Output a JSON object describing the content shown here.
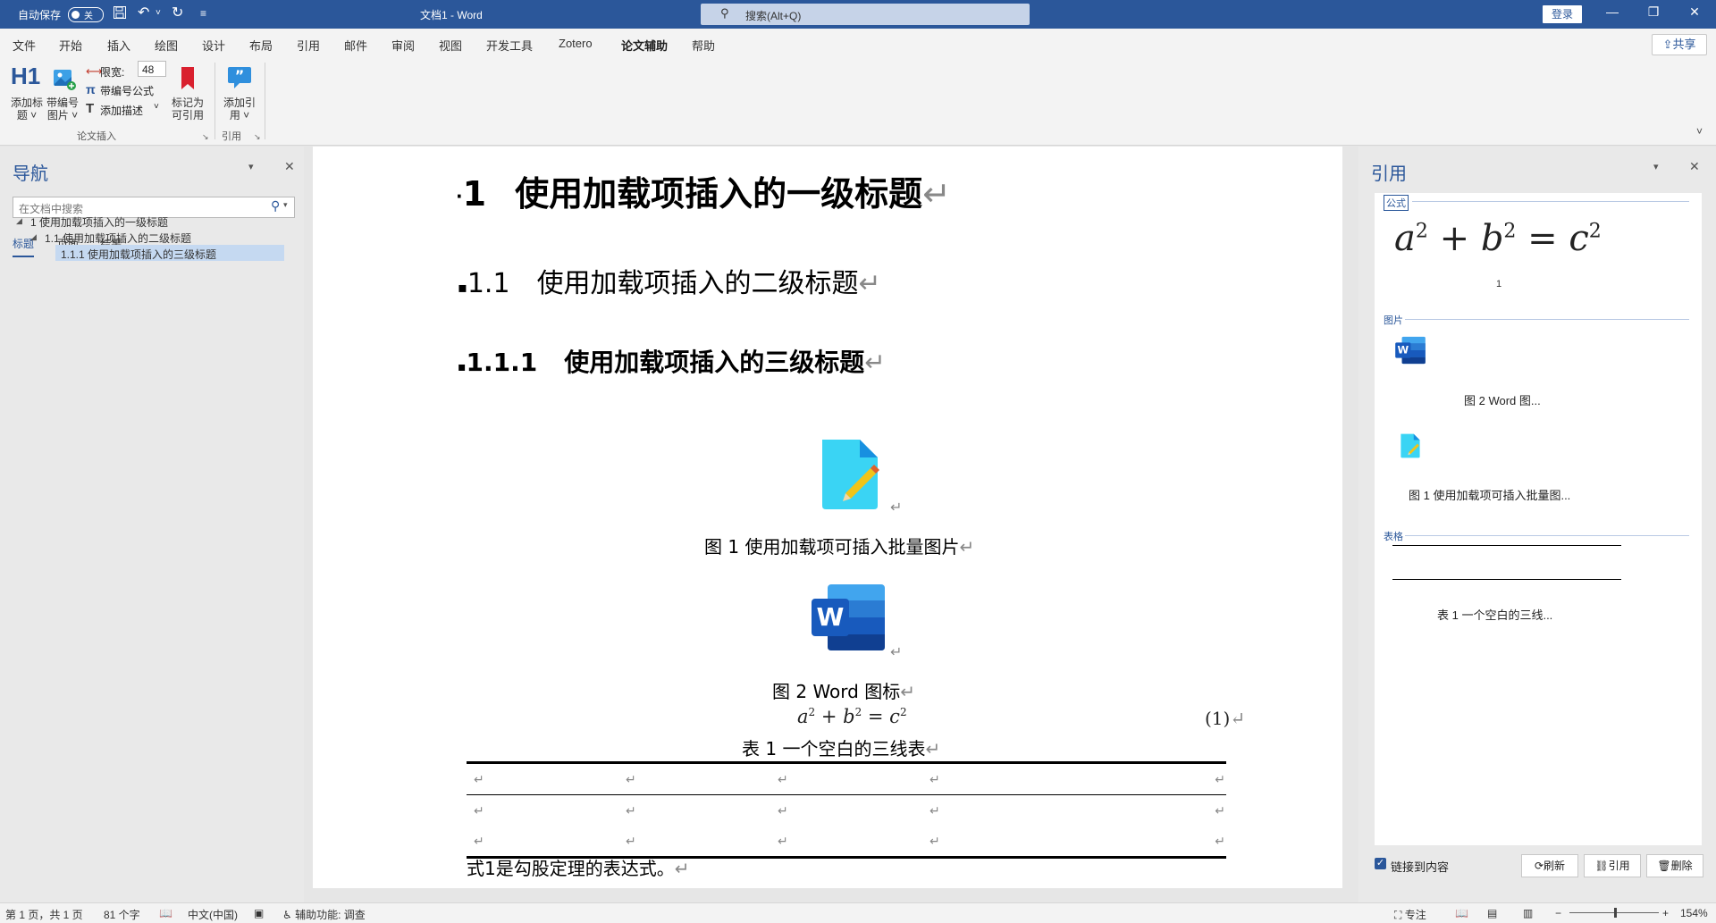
{
  "titlebar": {
    "autosave_label": "自动保存",
    "autosave_state": "关",
    "doc_title": "文档1 - Word",
    "search_placeholder": "搜索(Alt+Q)",
    "login_label": "登录"
  },
  "menu": {
    "tabs": [
      "文件",
      "开始",
      "插入",
      "绘图",
      "设计",
      "布局",
      "引用",
      "邮件",
      "审阅",
      "视图",
      "开发工具",
      "Zotero",
      "论文辅助",
      "帮助"
    ],
    "active_tab": "论文辅助",
    "share_label": "共享"
  },
  "ribbon": {
    "add_heading": "添加标\n题 ˅",
    "numbered_picture": "带编号\n图片 ˅",
    "width_label": "限宽:",
    "width_value": "48",
    "numbered_formula": "带编号公式",
    "add_description": "添加描述",
    "mark_citable": "标记为\n可引用",
    "group_paper_insert": "论文插入",
    "add_citation": "添加引\n用 ˅",
    "group_citation": "引用",
    "h1_glyph": "H1",
    "pi_glyph": "π",
    "t_glyph": "T",
    "width_glyph": "⟷"
  },
  "nav": {
    "title": "导航",
    "search_placeholder": "在文档中搜索",
    "tabs": [
      "标题",
      "页面",
      "结果"
    ],
    "headings": [
      {
        "text": "1   使用加载项插入的一级标题"
      },
      {
        "text": "1.1   使用加载项插入的二级标题"
      },
      {
        "text": "1.1.1   使用加载项插入的三级标题"
      }
    ]
  },
  "document": {
    "h1_num": "1",
    "h1_text": "使用加载项插入的一级标题",
    "h2_num": "1.1",
    "h2_text": "使用加载项插入的二级标题",
    "h3_num": "1.1.1",
    "h3_text": "使用加载项插入的三级标题",
    "fig1_caption": "图 1   使用加载项可插入批量图片",
    "fig2_caption": "图 2   Word 图标",
    "equation_number": "(1)",
    "table_caption": "表 1   一个空白的三线表",
    "body_text": "式1是勾股定理的表达式。",
    "para_mark": "↵",
    "word_glyph": "W"
  },
  "refpane": {
    "title": "引用",
    "section_formula": "公式",
    "formula_index": "1",
    "section_picture": "图片",
    "pic_captions": [
      "图 2  Word 图...",
      "图 1   使用加载项可插入批量图..."
    ],
    "section_table": "表格",
    "table_caption": "表 1   一个空白的三线...",
    "link_to_content": "链接到内容",
    "refresh_btn": "刷新",
    "cite_btn": "引用",
    "delete_btn": "删除"
  },
  "status": {
    "page": "第 1 页，共 1 页",
    "words": "81 个字",
    "language": "中文(中国)",
    "accessibility": "辅助功能: 调查",
    "focus": "专注",
    "zoom": "154%"
  },
  "colors": {
    "accent": "#2b579a",
    "title_bar": "#2b579a"
  }
}
